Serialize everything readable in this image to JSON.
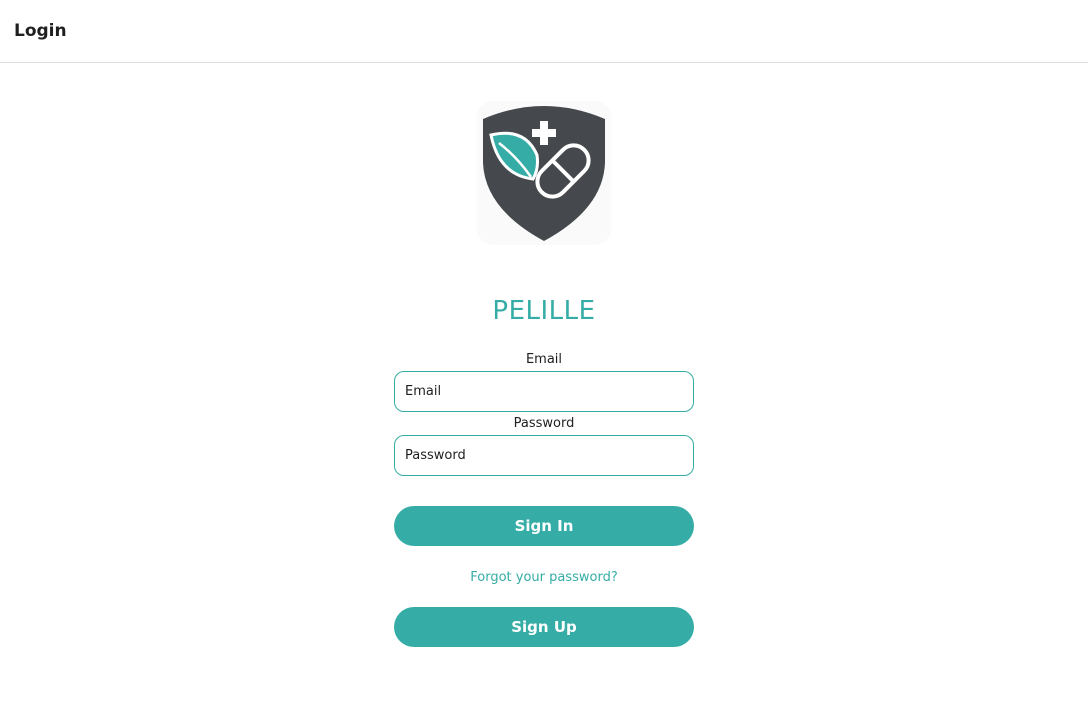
{
  "header": {
    "title": "Login"
  },
  "brand": {
    "name": "PELILLE",
    "logo_icon": "shield-leaf-pill-icon",
    "accent_color": "#35ada6",
    "logo_dark_color": "#45484c"
  },
  "form": {
    "email_label": "Email",
    "email_placeholder": "Email",
    "email_value": "",
    "password_label": "Password",
    "password_placeholder": "Password",
    "password_value": ""
  },
  "actions": {
    "sign_in_label": "Sign In",
    "forgot_password_label": "Forgot your password?",
    "sign_up_label": "Sign Up"
  }
}
